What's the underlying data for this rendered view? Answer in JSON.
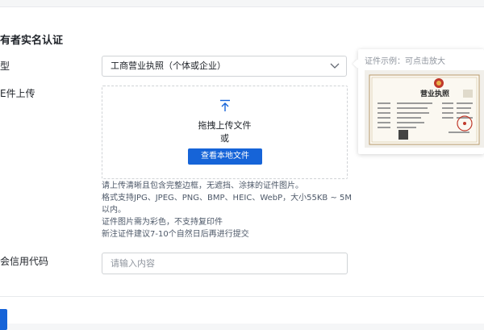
{
  "section": {
    "title": "有者实名认证"
  },
  "cert_type": {
    "label": "型",
    "selected": "工商营业执照（个体或企业）"
  },
  "example": {
    "caption": "证件示例：可点击放大",
    "license_title": "营业执照"
  },
  "upload": {
    "label": "E件上传",
    "drag_text": "拖拽上传文件",
    "or_text": "或",
    "browse_label": "查看本地文件"
  },
  "hints": [
    "请上传清晰且包含完整边框，无遮挡、涂抹的证件图片。",
    "格式支持JPG、JPEG、PNG、BMP、HEIC、WebP，大小55KB ~ 5M",
    "以内。",
    "证件图片需为彩色，不支持复印件",
    "新注证件建议7-10个自然日后再进行提交"
  ],
  "credit_code": {
    "label": "会信用代码",
    "placeholder": "请输入内容"
  },
  "colors": {
    "primary": "#1664d8",
    "seal": "#c0392b"
  }
}
